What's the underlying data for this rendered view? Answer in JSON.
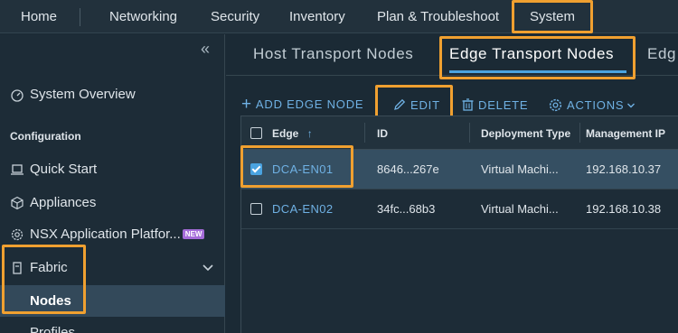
{
  "topnav": {
    "items": [
      "Home",
      "Networking",
      "Security",
      "Inventory",
      "Plan & Troubleshoot",
      "System"
    ],
    "active": "System"
  },
  "sidebar": {
    "collapse_glyph": "«",
    "system_overview": "System Overview",
    "section_configuration": "Configuration",
    "quick_start": "Quick Start",
    "appliances": "Appliances",
    "nsx_app_platform": "NSX Application Platfor...",
    "new_badge": "NEW",
    "fabric": "Fabric",
    "nodes": "Nodes",
    "profiles": "Profiles"
  },
  "tabs": {
    "host_transport_nodes": "Host Transport Nodes",
    "edge_transport_nodes": "Edge Transport Nodes",
    "overflow": "Edg"
  },
  "toolbar": {
    "add_edge_node": "ADD EDGE NODE",
    "edit": "EDIT",
    "delete": "DELETE",
    "actions": "ACTIONS"
  },
  "grid": {
    "columns": [
      "Edge",
      "ID",
      "Deployment Type",
      "Management IP"
    ],
    "rows": [
      {
        "edge": "DCA-EN01",
        "id": "8646...267e",
        "deployment_type": "Virtual Machi...",
        "management_ip": "192.168.10.37",
        "selected": true
      },
      {
        "edge": "DCA-EN02",
        "id": "34fc...68b3",
        "deployment_type": "Virtual Machi...",
        "management_ip": "192.168.10.38",
        "selected": false
      }
    ]
  },
  "colors": {
    "highlight": "#f0a030",
    "accent": "#4aa3e0",
    "link": "#6fb1e4",
    "selected_row": "#354f62"
  }
}
